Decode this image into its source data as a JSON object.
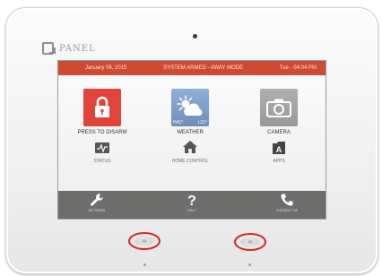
{
  "device": {
    "brand_prefix": "IQ",
    "brand_suffix": "PANEL"
  },
  "status_bar": {
    "date": "January 06, 2015",
    "system_status": "SYSTEM ARMED - AWAY MODE",
    "time": "Tue - 04:04 PM"
  },
  "tiles": [
    {
      "label": "PRESS TO DISARM",
      "icon": "padlock-icon",
      "color": "#e2443c"
    },
    {
      "label": "WEATHER",
      "icon": "sun-cloud-icon",
      "color": "#7fa0c8",
      "high": "H41°",
      "low": "L21°"
    },
    {
      "label": "CAMERA",
      "icon": "camera-icon",
      "color": "#a3a3a3"
    }
  ],
  "small_items": [
    {
      "label": "STATUS",
      "icon": "status-icon"
    },
    {
      "label": "HOME CONTROL",
      "icon": "home-icon"
    },
    {
      "label": "APPS",
      "icon": "apps-icon"
    }
  ],
  "bottom_bar": [
    {
      "label": "SETTINGS",
      "icon": "wrench-icon"
    },
    {
      "label": "HELP",
      "icon": "question-icon"
    },
    {
      "label": "CONTACT US",
      "icon": "phone-icon"
    }
  ],
  "colors": {
    "status_bar": "#cf4a33",
    "bottom_bar": "#6d6e6c",
    "highlight_ring": "#d8261b"
  }
}
